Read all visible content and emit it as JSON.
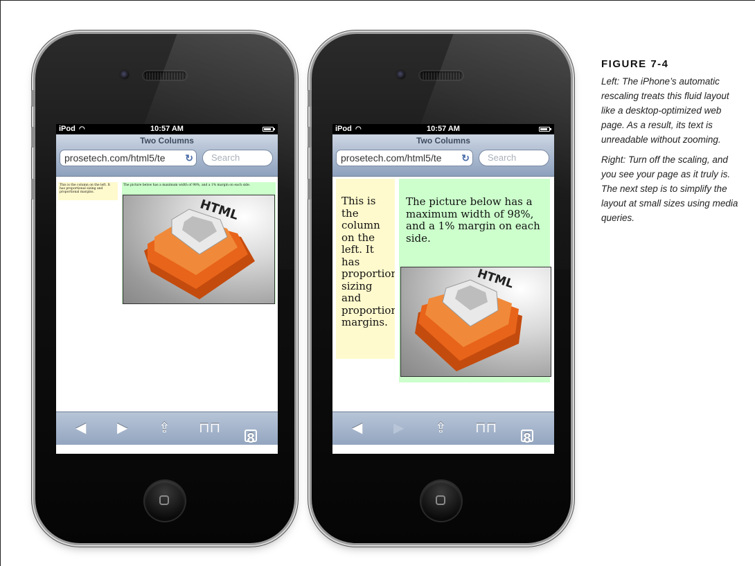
{
  "figure": {
    "title": "FIGURE 7-4",
    "caption_left": "Left: The iPhone’s automatic rescaling treats this fluid layout like a desktop-optimized web page. As a result, its text is unreadable without zooming.",
    "caption_right": "Right: Turn off the scaling, and you see your page as it truly is. The next step is to simplify the layout at small sizes using media queries."
  },
  "status": {
    "carrier": "iPod",
    "time": "10:57 AM"
  },
  "browser": {
    "page_title": "Two Columns",
    "url": "prosetech.com/html5/te",
    "search_placeholder": "Search",
    "tabs_count": "8"
  },
  "page": {
    "left_text": "This is the column on the left. It has proportional sizing and proportional margins.",
    "right_text": "The picture below has a maximum width of 98%, and a 1% margin on each side.",
    "logo_text": "HTML",
    "logo_digit": "5"
  },
  "colors": {
    "left_column": "#fffacd",
    "right_column": "#ccffcc",
    "logo_orange": "#e8641a"
  },
  "icons": {
    "back": "back-arrow-icon",
    "forward": "forward-arrow-icon",
    "share": "share-icon",
    "bookmarks": "bookmarks-icon",
    "tabs": "tabs-icon",
    "wifi": "wifi-icon",
    "reload": "reload-icon"
  }
}
